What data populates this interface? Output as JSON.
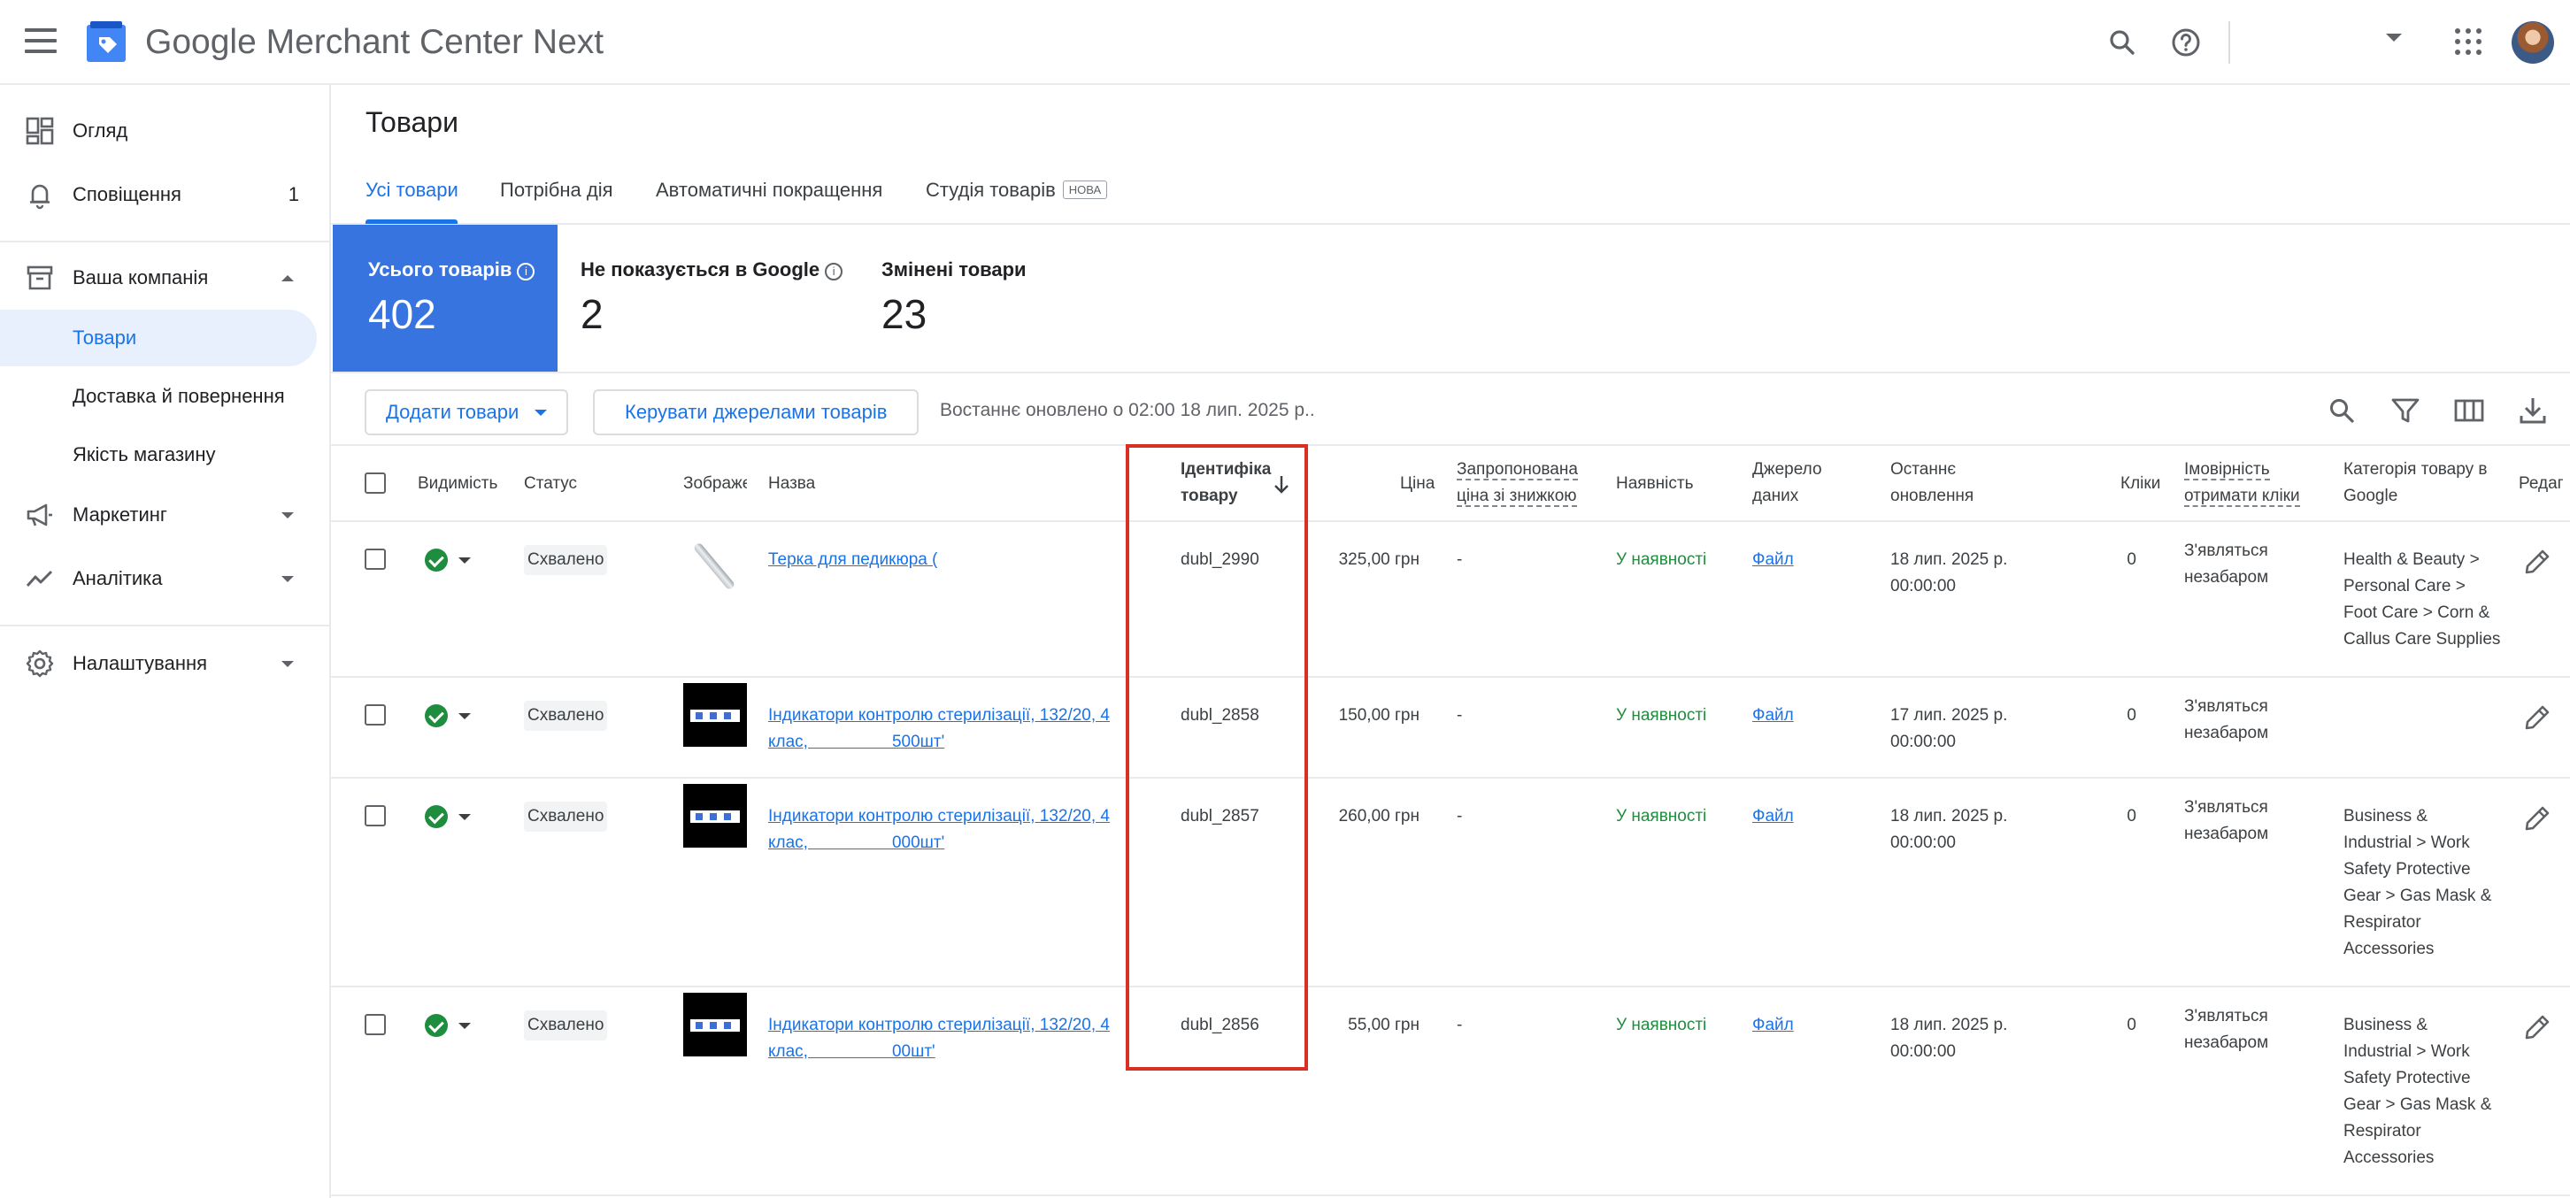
{
  "app": {
    "brand_google": "Google",
    "brand_rest": " Merchant Center Next"
  },
  "colors": {
    "accent": "#1a73e8",
    "stat_active": "#3874e0",
    "ok_green": "#1e8e3e",
    "highlight": "#d93025"
  },
  "sidebar": {
    "overview": "Огляд",
    "notifications": "Сповіщення",
    "notifications_count": "1",
    "company": "Ваша компанія",
    "products": "Товари",
    "shipping": "Доставка й повернення",
    "store_quality": "Якість магазину",
    "marketing": "Маркетинг",
    "analytics": "Аналітика",
    "settings": "Налаштування"
  },
  "page": {
    "title": "Товари",
    "tabs": [
      "Усі товари",
      "Потрібна дія",
      "Автоматичні покращення",
      "Студія товарів"
    ],
    "new_badge": "НОВА"
  },
  "stats": [
    {
      "label": "Усього товарів",
      "value": "402"
    },
    {
      "label": "Не показується в Google",
      "value": "2"
    },
    {
      "label": "Змінені товари",
      "value": "23"
    }
  ],
  "toolbar": {
    "add_products": "Додати товари",
    "manage_sources": "Керувати джерелами товарів",
    "last_updated": "Востаннє оновлено о 02:00 18 лип. 2025 р.."
  },
  "table": {
    "headers": {
      "visibility": "Видимість",
      "status": "Статус",
      "image": "Зображе",
      "name": "Назва",
      "id_1": "Ідентифіка",
      "id_2": "товару",
      "price": "Ціна",
      "sale_1": "Запропонована",
      "sale_2": "ціна зі знижкою",
      "availability": "Наявність",
      "source_1": "Джерело",
      "source_2": "даних",
      "updated_1": "Останнє",
      "updated_2": "оновлення",
      "clicks": "Кліки",
      "prob_1": "Імовірність",
      "prob_2": "отримати кліки",
      "cat_1": "Категорія товару в",
      "cat_2": "Google",
      "edit": "Редаг"
    },
    "rows": [
      {
        "status": "Схвалено",
        "name_1": "Терка для педикюра (",
        "name_2": "",
        "id": "dubl_2990",
        "price": "325,00 грн",
        "sale": "-",
        "availability": "У наявності",
        "source": "Файл",
        "updated_1": "18 лип. 2025 р.",
        "updated_2": "00:00:00",
        "clicks": "0",
        "prob_1": "З'являться",
        "prob_2": "незабаром",
        "category": [
          "Health & Beauty >",
          "Personal Care >",
          "Foot Care > Corn &",
          "Callus Care Supplies"
        ]
      },
      {
        "status": "Схвалено",
        "name_1": "Індикатори контролю стерилізації, 132/20, 4",
        "name_2": "клас,                  500шт'",
        "id": "dubl_2858",
        "price": "150,00 грн",
        "sale": "-",
        "availability": "У наявності",
        "source": "Файл",
        "updated_1": "17 лип. 2025 р.",
        "updated_2": "00:00:00",
        "clicks": "0",
        "prob_1": "З'являться",
        "prob_2": "незабаром",
        "category": []
      },
      {
        "status": "Схвалено",
        "name_1": "Індикатори контролю стерилізації, 132/20, 4",
        "name_2": "клас,                  000шт'",
        "id": "dubl_2857",
        "price": "260,00 грн",
        "sale": "-",
        "availability": "У наявності",
        "source": "Файл",
        "updated_1": "18 лип. 2025 р.",
        "updated_2": "00:00:00",
        "clicks": "0",
        "prob_1": "З'являться",
        "prob_2": "незабаром",
        "category": [
          "Business &",
          "Industrial > Work",
          "Safety Protective",
          "Gear > Gas Mask &",
          "Respirator",
          "Accessories"
        ]
      },
      {
        "status": "Схвалено",
        "name_1": "Індикатори контролю стерилізації, 132/20, 4",
        "name_2": "клас,                  00шт'",
        "id": "dubl_2856",
        "price": "55,00 грн",
        "sale": "-",
        "availability": "У наявності",
        "source": "Файл",
        "updated_1": "18 лип. 2025 р.",
        "updated_2": "00:00:00",
        "clicks": "0",
        "prob_1": "З'являться",
        "prob_2": "незабаром",
        "category": [
          "Business &",
          "Industrial > Work",
          "Safety Protective",
          "Gear > Gas Mask &",
          "Respirator",
          "Accessories"
        ]
      }
    ]
  }
}
